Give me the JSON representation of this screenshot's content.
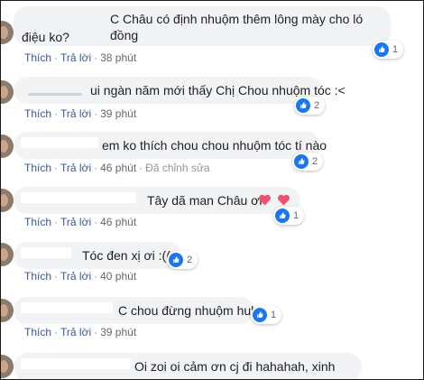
{
  "labels": {
    "like": "Thích",
    "reply": "Trả lời",
    "sep": "·"
  },
  "comments": [
    {
      "text_line1": "C Châu có định nhuộm thêm lông mày cho ló đồng",
      "text_line2": "điệu ko?",
      "time": "38 phút",
      "reactions": "1"
    },
    {
      "text": "ui ngàn năm mới thấy Chị Chou nhuộm tóc :<",
      "time": "39 phút",
      "reactions": "2"
    },
    {
      "text": "em ko thích chou chou nhuộm tóc tí nào",
      "time": "46 phút",
      "edited": "Đã chỉnh sửa",
      "reactions": "2"
    },
    {
      "text": "Tây dã man Châu ơi",
      "time": "46 phút",
      "reactions": "1"
    },
    {
      "text": "Tóc đen xị ơi :((",
      "time": "40 phút",
      "reactions": "2"
    },
    {
      "text": "C chou đừng nhuộm huhu",
      "time": "39 phút",
      "reactions": "1"
    },
    {
      "text": "Oi zoi oi cảm ơn cj đi hahahah, xinh"
    }
  ],
  "colors": {
    "bubble": "#f2f3f5",
    "action_link": "#385898",
    "like_blue": "#1877f2",
    "heart_red": "#f0506e"
  }
}
